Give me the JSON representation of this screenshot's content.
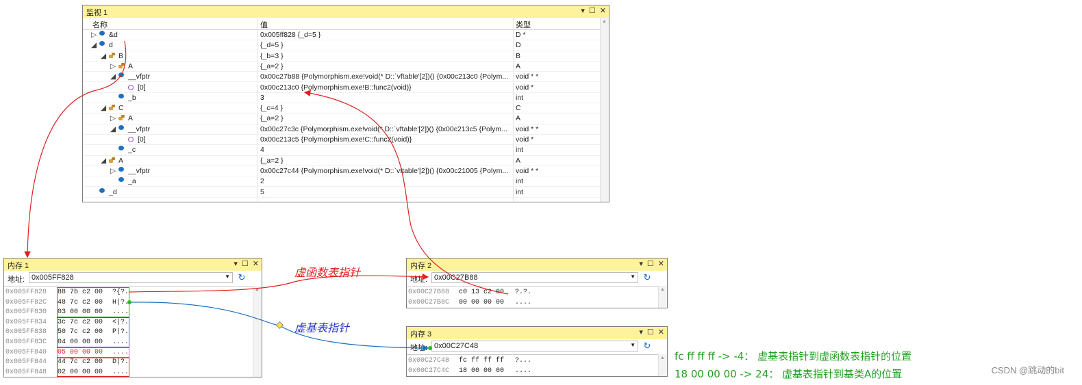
{
  "watch": {
    "title": "监视 1",
    "col_name": "名称",
    "col_value": "值",
    "col_type": "类型",
    "rows": [
      {
        "name": "&d",
        "value": "0x005ff828 {_d=5 }",
        "type": "D *",
        "expander": "▷",
        "icon": "variable-icon"
      },
      {
        "name": "d",
        "value": "{_d=5 }",
        "type": "D",
        "expander": "◢",
        "icon": "variable-icon"
      },
      {
        "name": "B",
        "value": "{_b=3 }",
        "type": "B",
        "expander": "◢",
        "icon": "base-class-icon"
      },
      {
        "name": "A",
        "value": "{_a=2 }",
        "type": "A",
        "expander": "▷",
        "icon": "base-class-icon"
      },
      {
        "name": "__vfptr",
        "value": "0x00c27b88 {Polymorphism.exe!void(* D::`vftable'[2])() {0x00c213c0 {Polym...",
        "type": "void * *",
        "expander": "◢",
        "icon": "variable-icon"
      },
      {
        "name": "[0]",
        "value": "0x00c213c0 {Polymorphism.exe!B::func2(void)}",
        "type": "void *",
        "expander": "",
        "icon": "array-element-icon"
      },
      {
        "name": "_b",
        "value": "3",
        "type": "int",
        "expander": "",
        "icon": "variable-icon"
      },
      {
        "name": "C",
        "value": "{_c=4 }",
        "type": "C",
        "expander": "◢",
        "icon": "base-class-icon"
      },
      {
        "name": "A",
        "value": "{_a=2 }",
        "type": "A",
        "expander": "▷",
        "icon": "base-class-icon"
      },
      {
        "name": "__vfptr",
        "value": "0x00c27c3c {Polymorphism.exe!void(* D::`vftable'[2])() {0x00c213c5 {Polym...",
        "type": "void * *",
        "expander": "◢",
        "icon": "variable-icon"
      },
      {
        "name": "[0]",
        "value": "0x00c213c5 {Polymorphism.exe!C::func2(void)}",
        "type": "void *",
        "expander": "",
        "icon": "array-element-icon"
      },
      {
        "name": "_c",
        "value": "4",
        "type": "int",
        "expander": "",
        "icon": "variable-icon"
      },
      {
        "name": "A",
        "value": "{_a=2 }",
        "type": "A",
        "expander": "◢",
        "icon": "base-class-icon"
      },
      {
        "name": "__vfptr",
        "value": "0x00c27c44 {Polymorphism.exe!void(* D::`vftable'[2])() {0x00c21005 {Polym...",
        "type": "void * *",
        "expander": "▷",
        "icon": "variable-icon"
      },
      {
        "name": "_a",
        "value": "2",
        "type": "int",
        "expander": "",
        "icon": "variable-icon"
      },
      {
        "name": "_d",
        "value": "5",
        "type": "int",
        "expander": "",
        "icon": "variable-icon"
      }
    ]
  },
  "window_buttons": {
    "dropdown": "▾",
    "restore": "☐",
    "close": "✕"
  },
  "memory1": {
    "title": "内存 1",
    "addr_label": "地址:",
    "address": "0x005FF828",
    "rows": [
      {
        "addr": "0x005FF828",
        "hex": "88 7b c2 00",
        "chars": "?{?."
      },
      {
        "addr": "0x005FF82C",
        "hex": "48 7c c2 00",
        "chars": "H|?."
      },
      {
        "addr": "0x005FF830",
        "hex": "03 00 00 00",
        "chars": "...."
      },
      {
        "addr": "0x005FF834",
        "hex": "3c 7c c2 00",
        "chars": "<|?."
      },
      {
        "addr": "0x005FF838",
        "hex": "50 7c c2 00",
        "chars": "P|?."
      },
      {
        "addr": "0x005FF83C",
        "hex": "04 00 00 00",
        "chars": "...."
      },
      {
        "addr": "0x005FF840",
        "hex": "05 00 00 00",
        "chars": "...."
      },
      {
        "addr": "0x005FF844",
        "hex": "44 7c c2 00",
        "chars": "D|?."
      },
      {
        "addr": "0x005FF848",
        "hex": "02 00 00 00",
        "chars": "...."
      }
    ]
  },
  "memory2": {
    "title": "内存 2",
    "addr_label": "地址:",
    "address": "0x00C27B88",
    "rows": [
      {
        "addr": "0x00C27B88",
        "hex": "c0 13 c2 00",
        "chars": "?.?."
      },
      {
        "addr": "0x00C27B8C",
        "hex": "00 00 00 00",
        "chars": "...."
      }
    ]
  },
  "memory3": {
    "title": "内存 3",
    "addr_label": "地址:",
    "address": "0x00C27C48",
    "rows": [
      {
        "addr": "0x00C27C48",
        "hex": "fc ff ff ff",
        "chars": "?..."
      },
      {
        "addr": "0x00C27C4C",
        "hex": "18 00 00 00",
        "chars": "...."
      }
    ]
  },
  "annotations": {
    "vftable_pointer": "虚函数表指针",
    "vbtable_pointer": "虚基表指针",
    "note1": "fc ff ff ff -> -4： 虚基表指针到虚函数表指针的位置",
    "note2": "18 00 00 00 -> 24： 虚基表指针到基类A的位置",
    "watermark": "CSDN @跳动的bit"
  },
  "colors": {
    "title_bar": "#fff29d",
    "red_arrow": "#e02020",
    "blue_arrow": "#1f6fbf",
    "green_note": "#22a022",
    "annotation_blue": "#2b36c8"
  }
}
